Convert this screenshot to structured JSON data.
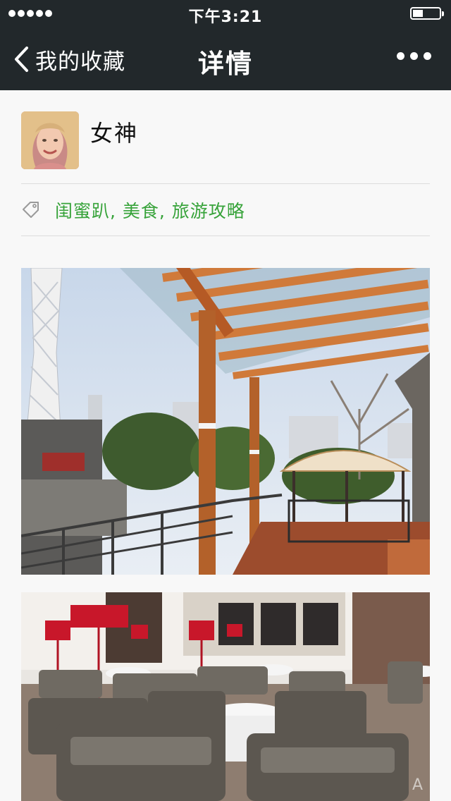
{
  "status_bar": {
    "time": "下午3:21",
    "signal_dots": 5,
    "battery_level": 0.35
  },
  "nav": {
    "back_label": "我的收藏",
    "title": "详情",
    "more_icon": "more-dots-icon",
    "back_icon": "chevron-left-icon"
  },
  "profile": {
    "name": "女神"
  },
  "tags": {
    "icon": "tag-icon",
    "text": "闺蜜趴, 美食, 旅游攻略"
  },
  "colors": {
    "nav_bg": "#22282b",
    "tag_green": "#37a33a",
    "content_bg": "#f8f8f8"
  }
}
